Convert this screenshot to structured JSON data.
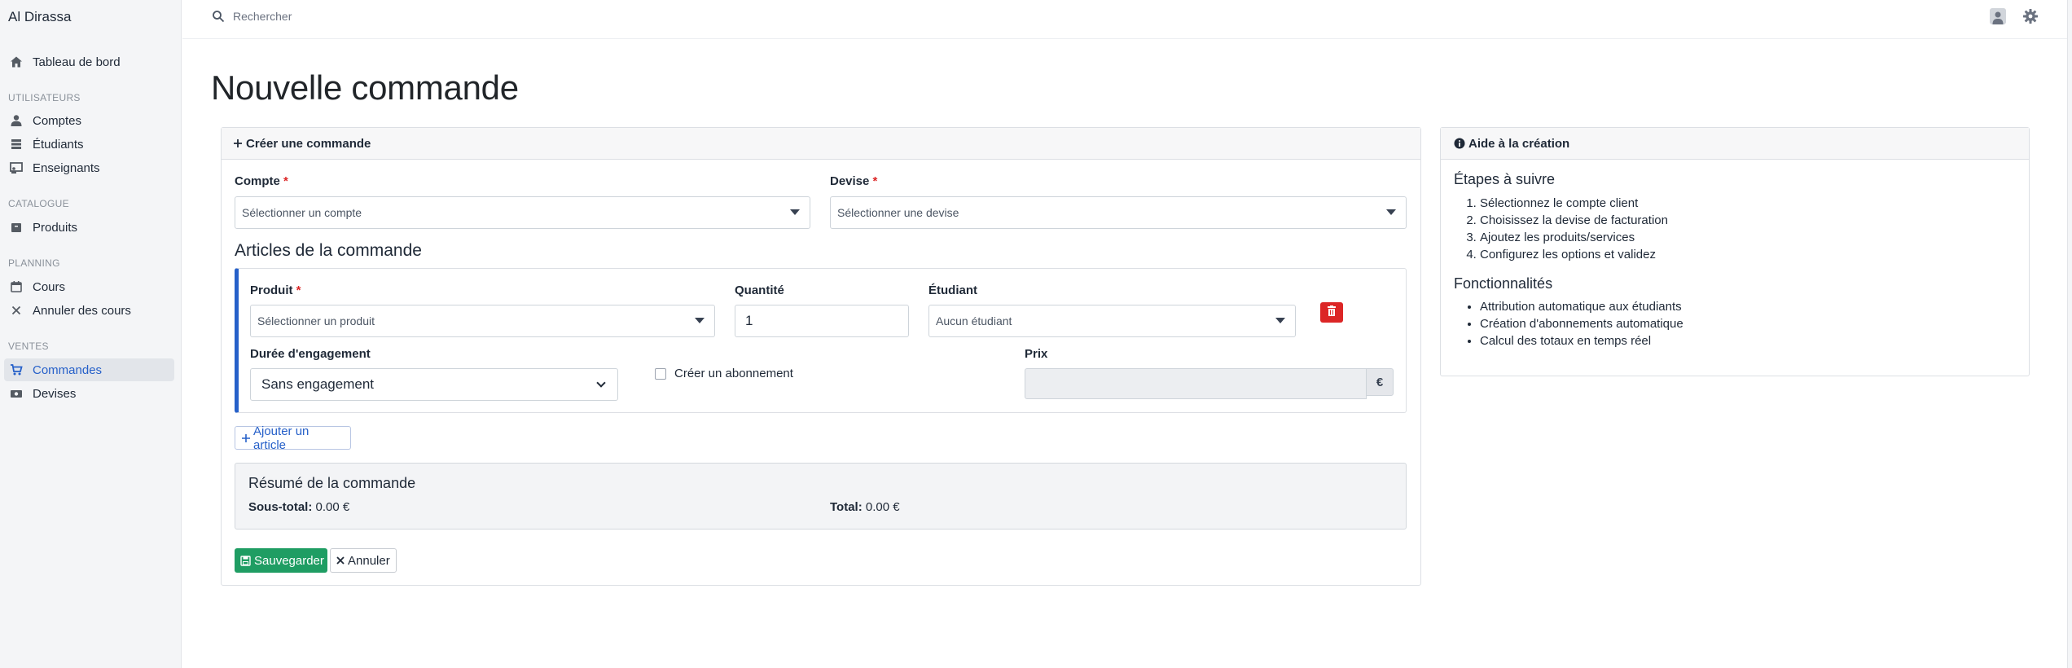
{
  "sidebar": {
    "brand": "Al Dirassa",
    "dashboard": "Tableau de bord",
    "sections": {
      "users": "UTILISATEURS",
      "catalog": "CATALOGUE",
      "planning": "PLANNING",
      "sales": "VENTES"
    },
    "items": {
      "accounts": "Comptes",
      "students": "Étudiants",
      "teachers": "Enseignants",
      "products": "Produits",
      "courses": "Cours",
      "cancel_courses": "Annuler des cours",
      "orders": "Commandes",
      "currencies": "Devises"
    },
    "active_item": "Commandes",
    "active_color": "#2660c9"
  },
  "header": {
    "search_placeholder": "Rechercher",
    "icons": [
      "search-icon",
      "user-icon",
      "gear-icon"
    ]
  },
  "page": {
    "title": "Nouvelle commande"
  },
  "form": {
    "card_title": "Créer une commande",
    "account_label": "Compte",
    "account_placeholder": "Sélectionner un compte",
    "currency_label": "Devise",
    "currency_placeholder": "Sélectionner une devise",
    "required_mark": "*",
    "articles_title": "Articles de la commande",
    "article": {
      "product_label": "Produit",
      "product_placeholder": "Sélectionner un produit",
      "quantity_label": "Quantité",
      "quantity_value": "1",
      "student_label": "Étudiant",
      "student_value": "Aucun étudiant",
      "duration_label": "Durée d'engagement",
      "duration_value": "Sans engagement",
      "subscription_label": "Créer un abonnement",
      "subscription_checked": false,
      "price_label": "Prix",
      "price_value": "",
      "currency_symbol": "€"
    },
    "add_article": "Ajouter un article",
    "summary": {
      "title": "Résumé de la commande",
      "subtotal_label": "Sous-total:",
      "subtotal_value": "0.00 €",
      "total_label": "Total:",
      "total_value": "0.00 €"
    },
    "save_label": "Sauvegarder",
    "cancel_label": "Annuler",
    "save_color": "#1f9d63",
    "delete_color": "#dc2626"
  },
  "help": {
    "card_title": "Aide à la création",
    "steps_title": "Étapes à suivre",
    "steps": [
      "Sélectionnez le compte client",
      "Choisissez la devise de facturation",
      "Ajoutez les produits/services",
      "Configurez les options et validez"
    ],
    "features_title": "Fonctionnalités",
    "features": [
      "Attribution automatique aux étudiants",
      "Création d'abonnements automatique",
      "Calcul des totaux en temps réel"
    ]
  }
}
